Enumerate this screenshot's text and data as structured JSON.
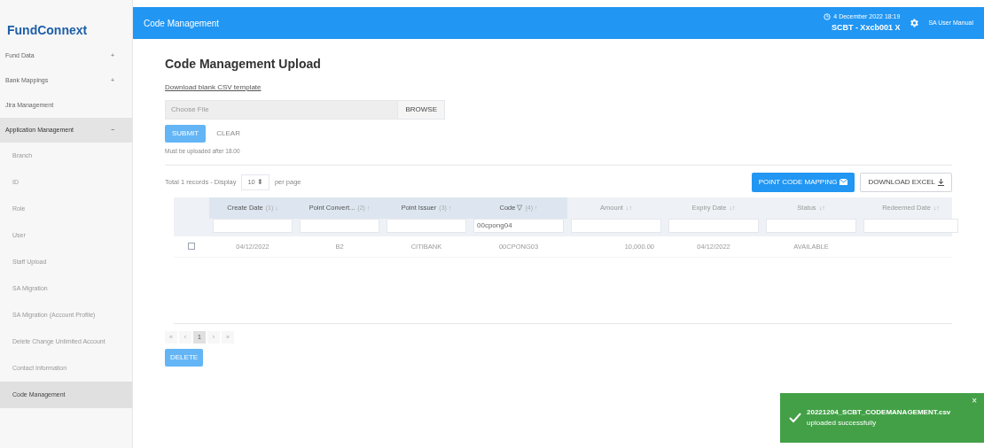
{
  "sidebar": {
    "brand": "FundConnext",
    "items": [
      {
        "label": "Fund Data",
        "toggle": "+",
        "expanded": false,
        "selected": false
      },
      {
        "label": "Bank Mappings",
        "toggle": "+",
        "expanded": false,
        "selected": false
      },
      {
        "label": "Jira Management",
        "expanded": false,
        "selected": false
      },
      {
        "label": "Application Management",
        "toggle": "−",
        "expanded": true,
        "selected": false,
        "children": [
          {
            "label": "Branch",
            "selected": false
          },
          {
            "label": "ID",
            "selected": false
          },
          {
            "label": "Role",
            "selected": false
          },
          {
            "label": "User",
            "selected": false
          },
          {
            "label": "Staff Upload",
            "selected": false
          },
          {
            "label": "SA Migration",
            "selected": false
          },
          {
            "label": "SA Migration (Account Profile)",
            "selected": false
          },
          {
            "label": "Delete Change Unlimited Account",
            "selected": false
          },
          {
            "label": "Contact Information",
            "selected": false
          },
          {
            "label": "Code Management",
            "selected": true
          }
        ]
      }
    ]
  },
  "header": {
    "title": "Code Management",
    "datetime": "4 December 2022 18:19",
    "company": "SCBT - Xxcb001 X",
    "user_manual": "SA User Manual"
  },
  "upload": {
    "title": "Code Management Upload",
    "template_link": "Download blank CSV template",
    "file_placeholder": "Choose File",
    "browse": "BROWSE",
    "submit": "SUBMIT",
    "clear": "CLEAR",
    "note": "Must be uploaded after 18.00"
  },
  "table": {
    "total_text": "Total 1 records - Display",
    "page_size": "10 ⬍",
    "per_page": "per page",
    "mapping_button": "POINT CODE MAPPING",
    "download_button": "DOWNLOAD EXCEL",
    "columns": [
      {
        "label": "Create Date",
        "sort": "(1) ↓",
        "highlight": true
      },
      {
        "label": "Point Convert...",
        "sort": "(2) ↑",
        "highlight": true
      },
      {
        "label": "Point Issuer",
        "sort": "(3) ↑",
        "highlight": true
      },
      {
        "label": "Code ▽",
        "sort": "(4) ↑",
        "highlight": true,
        "filter": "00cpong04"
      },
      {
        "label": "Amount",
        "sort": "↓↑",
        "highlight": false
      },
      {
        "label": "Expiry Date",
        "sort": "↓↑",
        "highlight": false
      },
      {
        "label": "Status",
        "sort": "↓↑",
        "highlight": false
      },
      {
        "label": "Redeemed Date",
        "sort": "↓↑",
        "highlight": false
      }
    ],
    "rows": [
      {
        "checked": false,
        "cells": [
          "04/12/2022",
          "B2",
          "CITIBANK",
          "00CPONG03",
          "10,000.00",
          "04/12/2022",
          "AVAILABLE",
          ""
        ]
      }
    ],
    "pagination": [
      {
        "label": "«",
        "selected": false
      },
      {
        "label": "‹",
        "selected": false
      },
      {
        "label": "1",
        "selected": true
      },
      {
        "label": "›",
        "selected": false
      },
      {
        "label": "»",
        "selected": false
      }
    ],
    "delete_button": "DELETE"
  },
  "toast": {
    "close": "×",
    "file": "20221204_SCBT_CODEMANAGEMENT.csv",
    "message": "uploaded successfully"
  }
}
